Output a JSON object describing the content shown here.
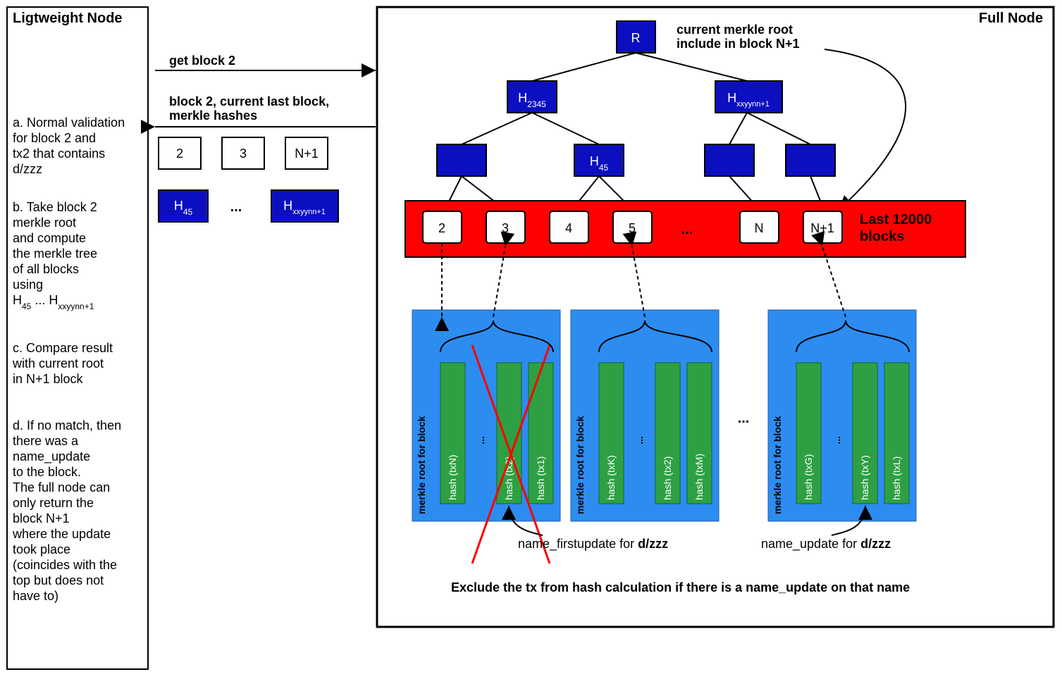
{
  "diagram_type": "blockchain / merkle-tree verification flow between a lightweight node and a full node",
  "lightweight": {
    "title": "Ligtweight Node",
    "steps": {
      "a": "a. Normal validation\n   for block 2 and\n   tx2 that contains\n   d/zzz",
      "b1": "b. Take block 2",
      "b2": "   merkle root",
      "b3": "   and compute",
      "b4": "   the merkle tree",
      "b5": "   of all blocks",
      "b6": "   using",
      "b7_prefix": "   H",
      "b7_sub1": "45",
      "b7_mid": " ... H",
      "b7_sub2": "xxyynn+1",
      "c": "c. Compare result\n   with current root\n   in N+1 block",
      "d": "d. If no match, then\n   there was a\n   name_update\n   to the block.\n   The full node can\n   only return the\n   block N+1\n   where the update\n   took place\n   (coincides with the\n   top but does not\n   have to)"
    }
  },
  "messages": {
    "request": "get block 2",
    "response1": "block 2, current last block,",
    "response2": "merkle hashes",
    "respBlocks": {
      "b1": "2",
      "b2": "3",
      "b3": "N+1"
    },
    "respHashes": {
      "h1": "H",
      "h1sub": "45",
      "dots": "...",
      "h2": "H",
      "h2sub": "xxyynn+1"
    }
  },
  "full": {
    "title": "Full Node",
    "rootNote1": "current merkle root",
    "rootNote2": "include in block N+1",
    "tree": {
      "root": "R",
      "L2a": "H",
      "L2asub": "2345",
      "L2b": "H",
      "L2bsub": "xxyynn+1",
      "H45": "H",
      "H45sub": "45"
    },
    "blocksBandTitle": "Last 12000\nblocks",
    "blocks": {
      "b1": "2",
      "b2": "3",
      "b3": "4",
      "b4": "5",
      "dots": "...",
      "bN": "N",
      "bNp1": "N+1"
    },
    "merkleBoxes": {
      "label": "merkle root for block",
      "box1": {
        "txA": "hash (txN)",
        "dots": "...",
        "txB": "hash (tx2)",
        "txC": "hash (tx1)"
      },
      "box2": {
        "txA": "hash (txK)",
        "dots": "...",
        "txB": "hash (tx2)",
        "txC": "hash (txM)"
      },
      "box3": {
        "txA": "hash (txG)",
        "dots": "...",
        "txB": "hash (txY)",
        "txC": "hash (txL)"
      }
    },
    "annot1a": "name_firstupdate for ",
    "annot1b": "d/zzz",
    "annot2a": "name_update for ",
    "annot2b": "d/zzz",
    "dotsBetween": "..."
  },
  "footer": "Exclude the tx from hash calculation if there is a name_update on that name",
  "colors": {
    "bluefill": "#0B0FC0",
    "border": "#000000",
    "redband": "#FF0000",
    "boxblue": "#2D8CF0",
    "green": "#2EA043",
    "redX": "#FF0000"
  }
}
